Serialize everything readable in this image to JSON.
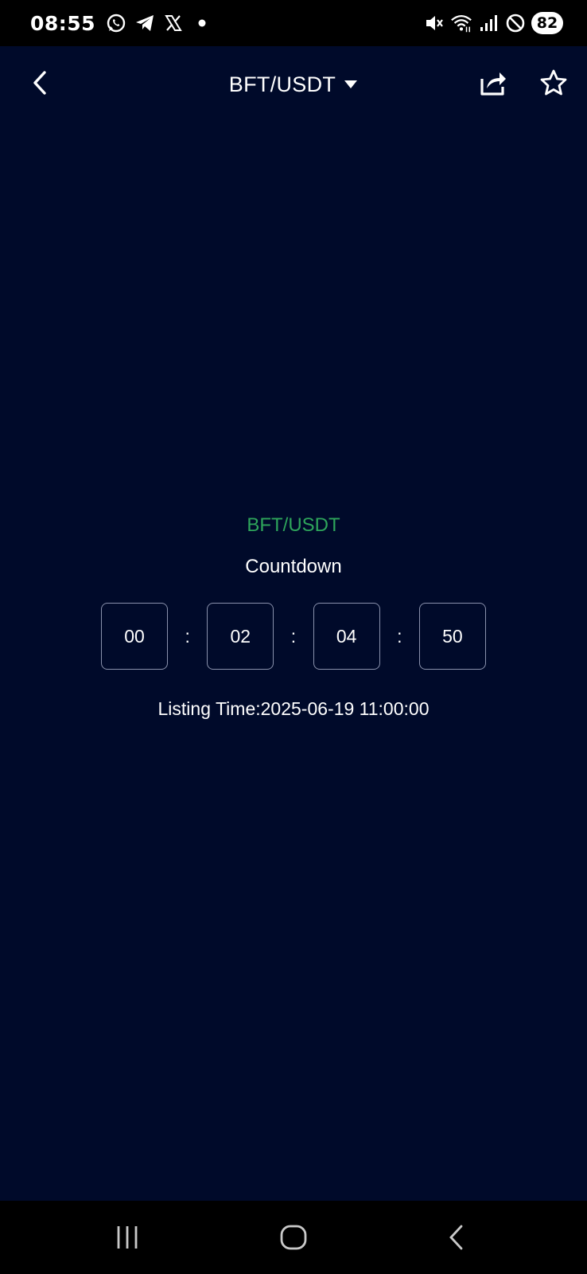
{
  "status_bar": {
    "time": "08:55",
    "battery_level": "82",
    "left_icons": [
      "whatsapp-icon",
      "telegram-icon",
      "x-icon",
      "notification-dot-icon"
    ],
    "right_icons": [
      "mute-icon",
      "wifi-icon",
      "cellular-signal-icon",
      "do-not-disturb-icon"
    ]
  },
  "header": {
    "title": "BFT/USDT",
    "icons": {
      "back": "chevron-left-icon",
      "dropdown": "caret-down-icon",
      "share": "share-icon",
      "favorite": "star-icon"
    }
  },
  "countdown": {
    "pair": "BFT/USDT",
    "label": "Countdown",
    "timer": {
      "days": "00",
      "hours": "02",
      "minutes": "04",
      "seconds": "50",
      "separator": ":"
    },
    "listing_time": "Listing Time:2025-06-19 11:00:00"
  },
  "colors": {
    "background": "#000a2a",
    "pair_text": "#2ea55b",
    "timer_border": "#8a92ad",
    "system_bars": "#000000"
  },
  "system_nav": {
    "buttons": [
      "recent-apps-icon",
      "home-icon",
      "back-icon"
    ]
  }
}
